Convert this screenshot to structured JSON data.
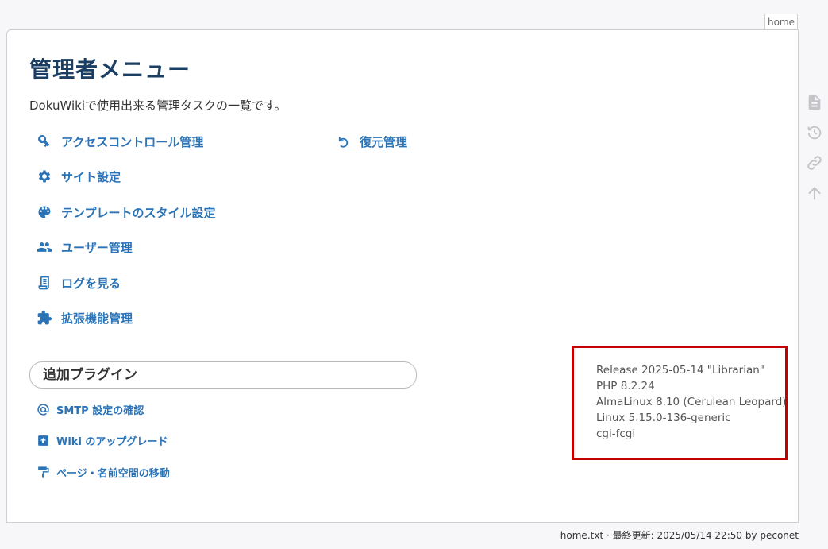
{
  "page_tab": {
    "label": "home"
  },
  "main": {
    "title": "管理者メニュー",
    "intro": "DokuWikiで使用出来る管理タスクの一覧です。",
    "admin_items": [
      {
        "label": "アクセスコントロール管理",
        "icon": "key-icon"
      },
      {
        "label": "サイト設定",
        "icon": "gear-icon"
      },
      {
        "label": "テンプレートのスタイル設定",
        "icon": "palette-icon"
      },
      {
        "label": "ユーザー管理",
        "icon": "users-icon"
      },
      {
        "label": "ログを見る",
        "icon": "log-icon"
      },
      {
        "label": "拡張機能管理",
        "icon": "puzzle-icon"
      }
    ],
    "revert_item": {
      "label": "復元管理",
      "icon": "undo-icon"
    },
    "plugins_heading": "追加プラグイン",
    "plugin_items": [
      {
        "label": "SMTP 設定の確認",
        "icon": "at-icon"
      },
      {
        "label": "Wiki のアップグレード",
        "icon": "upgrade-icon"
      },
      {
        "label": "ページ・名前空間の移動",
        "icon": "paint-roller-icon"
      }
    ],
    "version_info": [
      "Release 2025-05-14 \"Librarian\"",
      "PHP 8.2.24",
      "AlmaLinux 8.10 (Cerulean Leopard)",
      "Linux 5.15.0-136-generic",
      "cgi-fcgi"
    ]
  },
  "page_tools": [
    "show-page-icon",
    "history-icon",
    "backlinks-icon",
    "back-to-top-icon"
  ],
  "footer": {
    "text": "home.txt · 最終更新: 2025/05/14 22:50 by peconet"
  },
  "colors": {
    "link": "#2b73b7",
    "title": "#1b3e63",
    "highlight_border": "#c40000"
  }
}
